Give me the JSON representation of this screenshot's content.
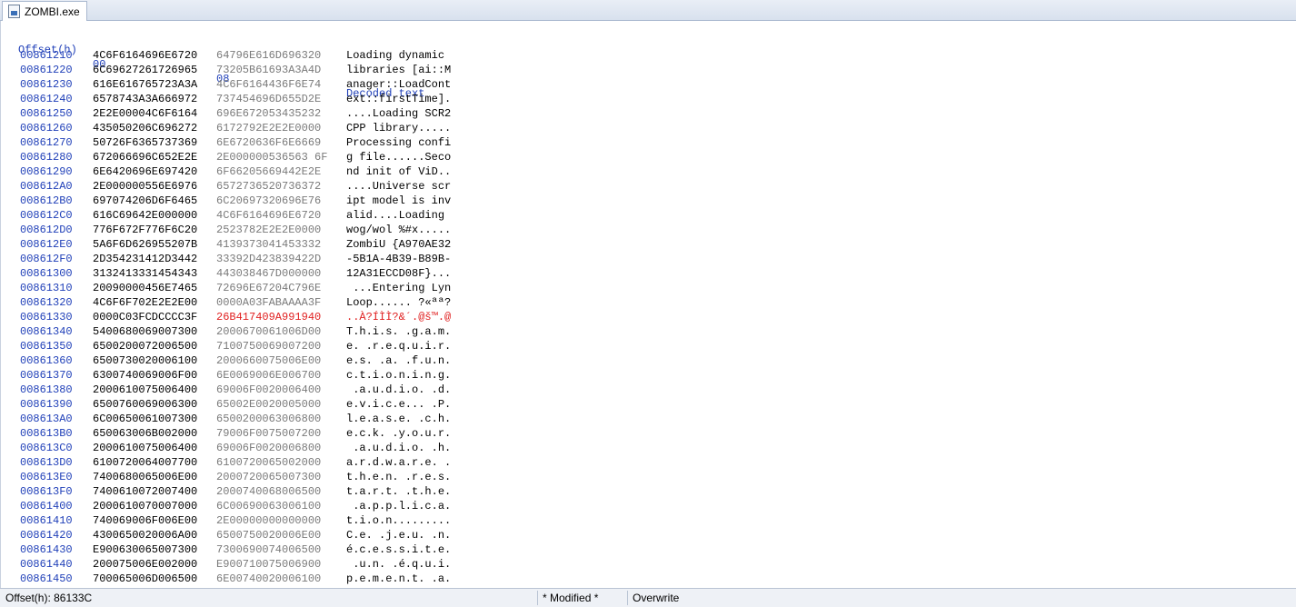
{
  "tab": {
    "label": "ZOMBI.exe",
    "icon": "document-binary-icon"
  },
  "header": {
    "offset": "Offset(h)",
    "col0": "00",
    "col8": "08",
    "decoded": "Decoded text"
  },
  "rows": [
    {
      "offset": "00861210",
      "h0": "4C6F6164696E6720",
      "h8": "64796E616D696320",
      "text": "Loading dynamic "
    },
    {
      "offset": "00861220",
      "h0": "6C69627261726965",
      "h8": "73205B61693A3A4D",
      "text": "libraries [ai::M"
    },
    {
      "offset": "00861230",
      "h0": "616E616765723A3A",
      "h8": "4C6F6164436F6E74",
      "text": "anager::LoadCont"
    },
    {
      "offset": "00861240",
      "h0": "6578743A3A666972",
      "h8": "737454696D655D2E",
      "text": "ext::firstTime]."
    },
    {
      "offset": "00861250",
      "h0": "2E2E00004C6F6164",
      "h8": "696E672053435232",
      "text": "....Loading SCR2"
    },
    {
      "offset": "00861260",
      "h0": "435050206C696272",
      "h8": "6172792E2E2E0000",
      "text": "CPP library....."
    },
    {
      "offset": "00861270",
      "h0": "50726F6365737369",
      "h8": "6E6720636F6E6669",
      "text": "Processing confi"
    },
    {
      "offset": "00861280",
      "h0": "672066696C652E2E",
      "h8": "2E000000536563 6F",
      "text": "g file......Seco"
    },
    {
      "offset": "00861290",
      "h0": "6E6420696E697420",
      "h8": "6F66205669442E2E",
      "text": "nd init of ViD.."
    },
    {
      "offset": "008612A0",
      "h0": "2E000000556E6976",
      "h8": "6572736520736372",
      "text": "....Universe scr"
    },
    {
      "offset": "008612B0",
      "h0": "697074206D6F6465",
      "h8": "6C20697320696E76",
      "text": "ipt model is inv"
    },
    {
      "offset": "008612C0",
      "h0": "616C69642E000000",
      "h8": "4C6F6164696E6720",
      "text": "alid....Loading "
    },
    {
      "offset": "008612D0",
      "h0": "776F672F776F6C20",
      "h8": "2523782E2E2E0000",
      "text": "wog/wol %#x....."
    },
    {
      "offset": "008612E0",
      "h0": "5A6F6D626955207B",
      "h8": "4139373041453332",
      "text": "ZombiU {A970AE32"
    },
    {
      "offset": "008612F0",
      "h0": "2D354231412D3442",
      "h8": "33392D423839422D",
      "text": "-5B1A-4B39-B89B-"
    },
    {
      "offset": "00861300",
      "h0": "3132413331454343",
      "h8": "443038467D000000",
      "text": "12A31ECCD08F}..."
    },
    {
      "offset": "00861310",
      "h0": "20090000456E7465",
      "h8": "72696E67204C796E",
      "text": " ...Entering Lyn"
    },
    {
      "offset": "00861320",
      "h0": "4C6F6F702E2E2E00",
      "h8": "0000A03FABAAAA3F",
      "text": "Loop...... ?«ªª?"
    },
    {
      "offset": "00861330",
      "h0": "0000C03FCDCCCC3F",
      "h8": "26B417409A991940",
      "text": "..À?ÍÌÌ?&´.@š™.@",
      "modified": true
    },
    {
      "offset": "00861340",
      "h0": "5400680069007300",
      "h8": "2000670061006D00",
      "text": "T.h.i.s. .g.a.m."
    },
    {
      "offset": "00861350",
      "h0": "6500200072006500",
      "h8": "7100750069007200",
      "text": "e. .r.e.q.u.i.r."
    },
    {
      "offset": "00861360",
      "h0": "6500730020006100",
      "h8": "2000660075006E00",
      "text": "e.s. .a. .f.u.n."
    },
    {
      "offset": "00861370",
      "h0": "6300740069006F00",
      "h8": "6E0069006E006700",
      "text": "c.t.i.o.n.i.n.g."
    },
    {
      "offset": "00861380",
      "h0": "2000610075006400",
      "h8": "69006F0020006400",
      "text": " .a.u.d.i.o. .d."
    },
    {
      "offset": "00861390",
      "h0": "6500760069006300",
      "h8": "65002E0020005000",
      "text": "e.v.i.c.e... .P."
    },
    {
      "offset": "008613A0",
      "h0": "6C00650061007300",
      "h8": "6500200063006800",
      "text": "l.e.a.s.e. .c.h."
    },
    {
      "offset": "008613B0",
      "h0": "650063006B002000",
      "h8": "79006F0075007200",
      "text": "e.c.k. .y.o.u.r."
    },
    {
      "offset": "008613C0",
      "h0": "2000610075006400",
      "h8": "69006F0020006800",
      "text": " .a.u.d.i.o. .h."
    },
    {
      "offset": "008613D0",
      "h0": "6100720064007700",
      "h8": "6100720065002000",
      "text": "a.r.d.w.a.r.e. ."
    },
    {
      "offset": "008613E0",
      "h0": "7400680065006E00",
      "h8": "2000720065007300",
      "text": "t.h.e.n. .r.e.s."
    },
    {
      "offset": "008613F0",
      "h0": "7400610072007400",
      "h8": "2000740068006500",
      "text": "t.a.r.t. .t.h.e."
    },
    {
      "offset": "00861400",
      "h0": "2000610070007000",
      "h8": "6C00690063006100",
      "text": " .a.p.p.l.i.c.a."
    },
    {
      "offset": "00861410",
      "h0": "740069006F006E00",
      "h8": "2E00000000000000",
      "text": "t.i.o.n........."
    },
    {
      "offset": "00861420",
      "h0": "4300650020006A00",
      "h8": "6500750020006E00",
      "text": "C.e. .j.e.u. .n."
    },
    {
      "offset": "00861430",
      "h0": "E900630065007300",
      "h8": "7300690074006500",
      "text": "é.c.e.s.s.i.t.e."
    },
    {
      "offset": "00861440",
      "h0": "200075006E002000",
      "h8": "E900710075006900",
      "text": " .u.n. .é.q.u.i."
    },
    {
      "offset": "00861450",
      "h0": "700065006D006500",
      "h8": "6E00740020006100",
      "text": "p.e.m.e.n.t. .a."
    }
  ],
  "status": {
    "offset": "Offset(h): 86133C",
    "modified": "* Modified *",
    "mode": "Overwrite"
  },
  "colors": {
    "offset_blue": "#1f3fb8",
    "modified_red": "#e02020",
    "hex_gray": "#7a7a7a"
  }
}
